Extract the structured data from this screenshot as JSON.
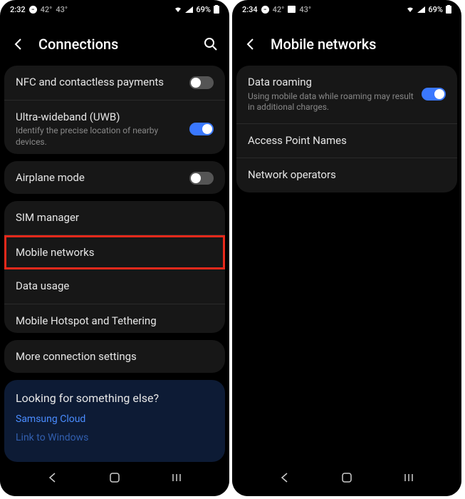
{
  "left": {
    "status": {
      "time": "2:32",
      "temp1": "42°",
      "temp2": "43°",
      "battery": "69%"
    },
    "header": {
      "title": "Connections"
    },
    "card1": {
      "nfc": {
        "title": "NFC and contactless payments",
        "on": false
      },
      "uwb": {
        "title": "Ultra-wideband (UWB)",
        "sub": "Identify the precise location of nearby devices.",
        "on": true
      }
    },
    "airplane": {
      "title": "Airplane mode",
      "on": false
    },
    "card2": {
      "sim": {
        "title": "SIM manager"
      },
      "mobile": {
        "title": "Mobile networks"
      },
      "data": {
        "title": "Data usage"
      },
      "hotspot": {
        "title": "Mobile Hotspot and Tethering"
      }
    },
    "more": {
      "title": "More connection settings"
    },
    "promo": {
      "title": "Looking for something else?",
      "link1": "Samsung Cloud",
      "link2": "Link to Windows"
    }
  },
  "right": {
    "status": {
      "time": "2:34",
      "temp1": "42°",
      "temp2": "43°",
      "battery": "69%"
    },
    "header": {
      "title": "Mobile networks"
    },
    "roaming": {
      "title": "Data roaming",
      "sub": "Using mobile data while roaming may result in additional charges.",
      "on": true
    },
    "apn": {
      "title": "Access Point Names"
    },
    "operators": {
      "title": "Network operators"
    }
  }
}
